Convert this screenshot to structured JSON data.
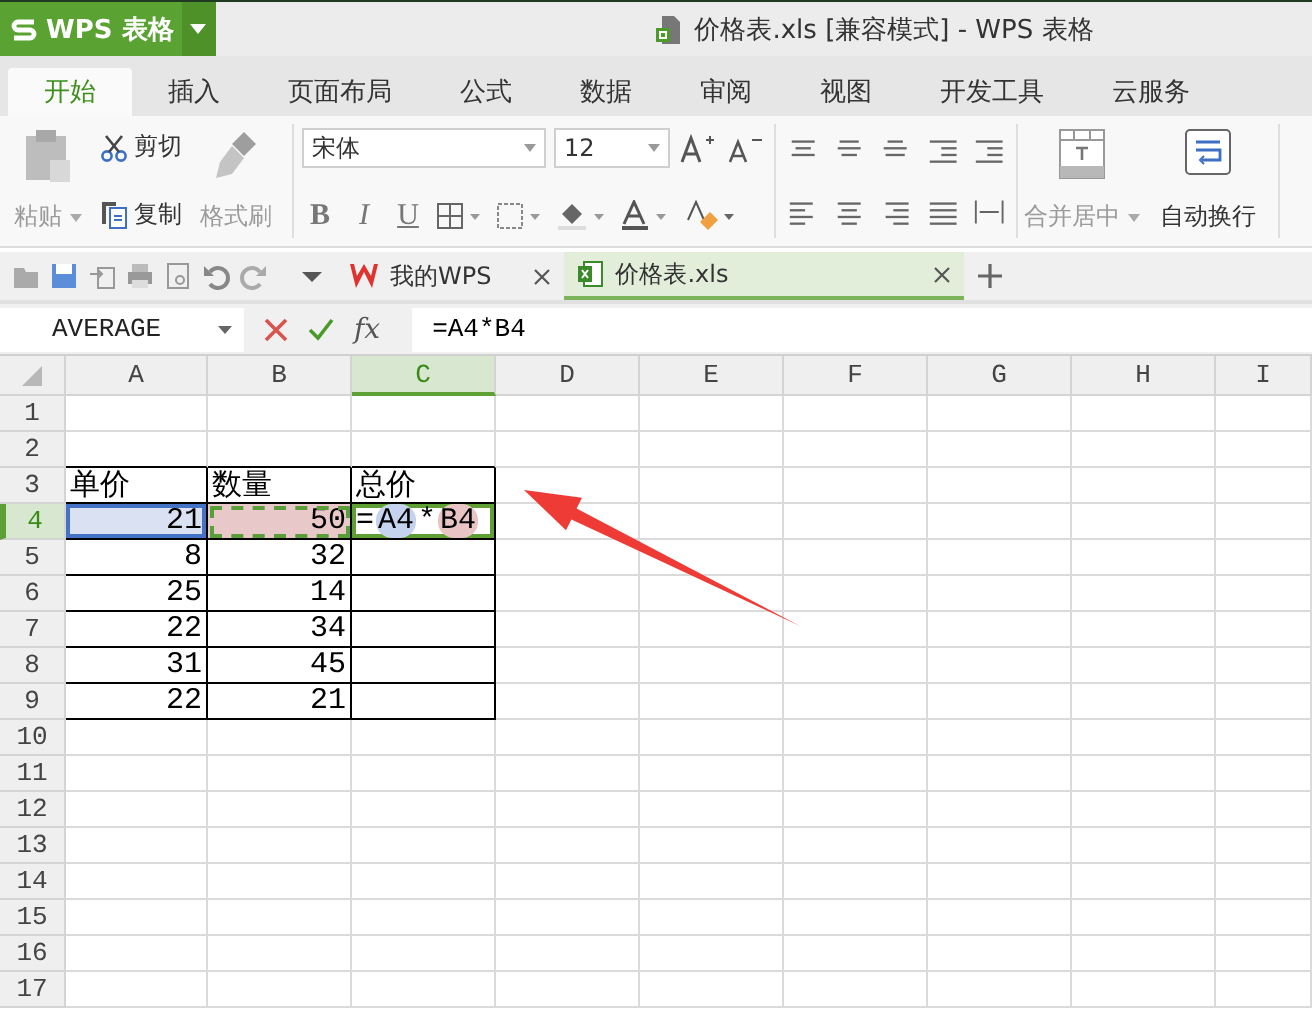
{
  "app": {
    "logo": "WPS 表格",
    "title": "价格表.xls [兼容模式] - WPS 表格"
  },
  "menu_tabs": [
    {
      "label": "开始",
      "selected": true
    },
    {
      "label": "插入",
      "selected": false
    },
    {
      "label": "页面布局",
      "selected": false
    },
    {
      "label": "公式",
      "selected": false
    },
    {
      "label": "数据",
      "selected": false
    },
    {
      "label": "审阅",
      "selected": false
    },
    {
      "label": "视图",
      "selected": false
    },
    {
      "label": "开发工具",
      "selected": false
    },
    {
      "label": "云服务",
      "selected": false
    }
  ],
  "ribbon": {
    "paste": {
      "label": "粘贴",
      "disabled": true
    },
    "cut": {
      "label": "剪切",
      "disabled": false
    },
    "copy": {
      "label": "复制",
      "disabled": false
    },
    "format_painter": {
      "label": "格式刷",
      "disabled": true
    },
    "font_name": "宋体",
    "font_size": "12",
    "font_styles": [
      "B",
      "I",
      "U"
    ],
    "merge_center": {
      "label": "合并居中",
      "disabled": true
    },
    "wrap_text": {
      "label": "自动换行",
      "disabled": false
    }
  },
  "doc_tabs": [
    {
      "label": "我的WPS",
      "selected": false
    },
    {
      "label": "价格表.xls",
      "selected": true
    }
  ],
  "formula_bar": {
    "name_box": "AVERAGE",
    "fx": "fx",
    "formula": "=A4*B4"
  },
  "sheet": {
    "columns": [
      {
        "label": "A",
        "selected": false
      },
      {
        "label": "B",
        "selected": false
      },
      {
        "label": "C",
        "selected": true
      },
      {
        "label": "D",
        "selected": false
      },
      {
        "label": "E",
        "selected": false
      },
      {
        "label": "F",
        "selected": false
      },
      {
        "label": "G",
        "selected": false
      },
      {
        "label": "H",
        "selected": false
      },
      {
        "label": "I",
        "selected": false
      }
    ],
    "rows": [
      {
        "label": "1",
        "selected": false
      },
      {
        "label": "2",
        "selected": false
      },
      {
        "label": "3",
        "selected": false,
        "cells": [
          {
            "kind": "header",
            "text": "单价"
          },
          {
            "kind": "header",
            "text": "数量"
          },
          {
            "kind": "header",
            "text": "总价"
          }
        ]
      },
      {
        "label": "4",
        "selected": true,
        "cells": [
          {
            "kind": "reference",
            "text": "21",
            "color": "#d9e1f3"
          },
          {
            "kind": "marquee",
            "text": "50",
            "color": "#e8c8c8"
          },
          {
            "kind": "formula",
            "parts": [
              {
                "text": "="
              },
              {
                "text": "A4",
                "color": "#c6d3ee"
              },
              {
                "text": "*"
              },
              {
                "text": "B4",
                "color": "#e8c4c4"
              }
            ]
          }
        ]
      },
      {
        "label": "5",
        "selected": false,
        "cells": [
          {
            "kind": "number",
            "text": "8"
          },
          {
            "kind": "number",
            "text": "32"
          },
          {
            "kind": "empty"
          }
        ]
      },
      {
        "label": "6",
        "selected": false,
        "cells": [
          {
            "kind": "number",
            "text": "25"
          },
          {
            "kind": "number",
            "text": "14"
          },
          {
            "kind": "empty"
          }
        ]
      },
      {
        "label": "7",
        "selected": false,
        "cells": [
          {
            "kind": "number",
            "text": "22"
          },
          {
            "kind": "number",
            "text": "34"
          },
          {
            "kind": "empty"
          }
        ]
      },
      {
        "label": "8",
        "selected": false,
        "cells": [
          {
            "kind": "number",
            "text": "31"
          },
          {
            "kind": "number",
            "text": "45"
          },
          {
            "kind": "empty"
          }
        ]
      },
      {
        "label": "9",
        "selected": false,
        "cells": [
          {
            "kind": "number",
            "text": "22"
          },
          {
            "kind": "number",
            "text": "21"
          },
          {
            "kind": "empty"
          }
        ]
      },
      {
        "label": "10",
        "selected": false
      },
      {
        "label": "11",
        "selected": false
      },
      {
        "label": "12",
        "selected": false
      },
      {
        "label": "13",
        "selected": false
      },
      {
        "label": "14",
        "selected": false
      },
      {
        "label": "15",
        "selected": false
      },
      {
        "label": "16",
        "selected": false
      },
      {
        "label": "17",
        "selected": false
      }
    ]
  }
}
